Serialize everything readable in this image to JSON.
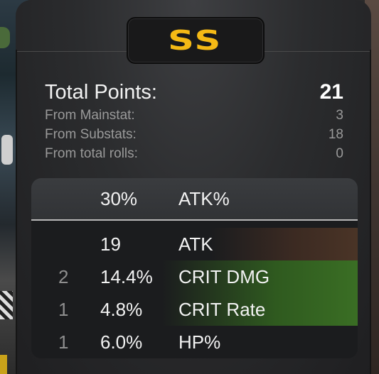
{
  "grade": "SS",
  "total": {
    "label": "Total Points:",
    "value": "21"
  },
  "breakdown": [
    {
      "label": "From Mainstat:",
      "value": "3"
    },
    {
      "label": "From Substats:",
      "value": "18"
    },
    {
      "label": "From total rolls:",
      "value": "0"
    }
  ],
  "main_stat": {
    "value": "30%",
    "name": "ATK%"
  },
  "substats": [
    {
      "count": "",
      "value": "19",
      "name": "ATK"
    },
    {
      "count": "2",
      "value": "14.4%",
      "name": "CRIT DMG"
    },
    {
      "count": "1",
      "value": "4.8%",
      "name": "CRIT Rate"
    },
    {
      "count": "1",
      "value": "6.0%",
      "name": "HP%"
    }
  ],
  "colors": {
    "grade": "#f4b915",
    "atk_highlight": "#4a3426",
    "crit_highlight": "#3a6e24"
  }
}
